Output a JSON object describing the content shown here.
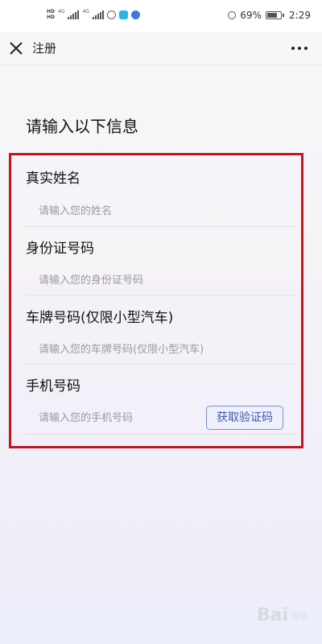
{
  "status_bar": {
    "battery_percent": "69%",
    "time": "2:29",
    "network": "4G",
    "hd_label": "HD"
  },
  "nav": {
    "title": "注册",
    "close_icon": "close-icon",
    "more_icon": "more-horizontal-icon"
  },
  "form": {
    "heading": "请输入以下信息",
    "fields": [
      {
        "label": "真实姓名",
        "placeholder": "请输入您的姓名",
        "value": ""
      },
      {
        "label": "身份证号码",
        "placeholder": "请输入您的身份证号码",
        "value": ""
      },
      {
        "label": "车牌号码(仅限小型汽车)",
        "placeholder": "请输入您的车牌号码(仅限小型汽车)",
        "value": ""
      },
      {
        "label": "手机号码",
        "placeholder": "请输入您的手机号码",
        "value": ""
      }
    ],
    "sms_button_label": "获取验证码"
  },
  "annotation": {
    "highlight_color": "#c1161c"
  },
  "colors": {
    "accent": "#3f5bb0",
    "annotation": "#c1161c"
  },
  "watermark": {
    "text": "Bai",
    "sub": "经验"
  }
}
